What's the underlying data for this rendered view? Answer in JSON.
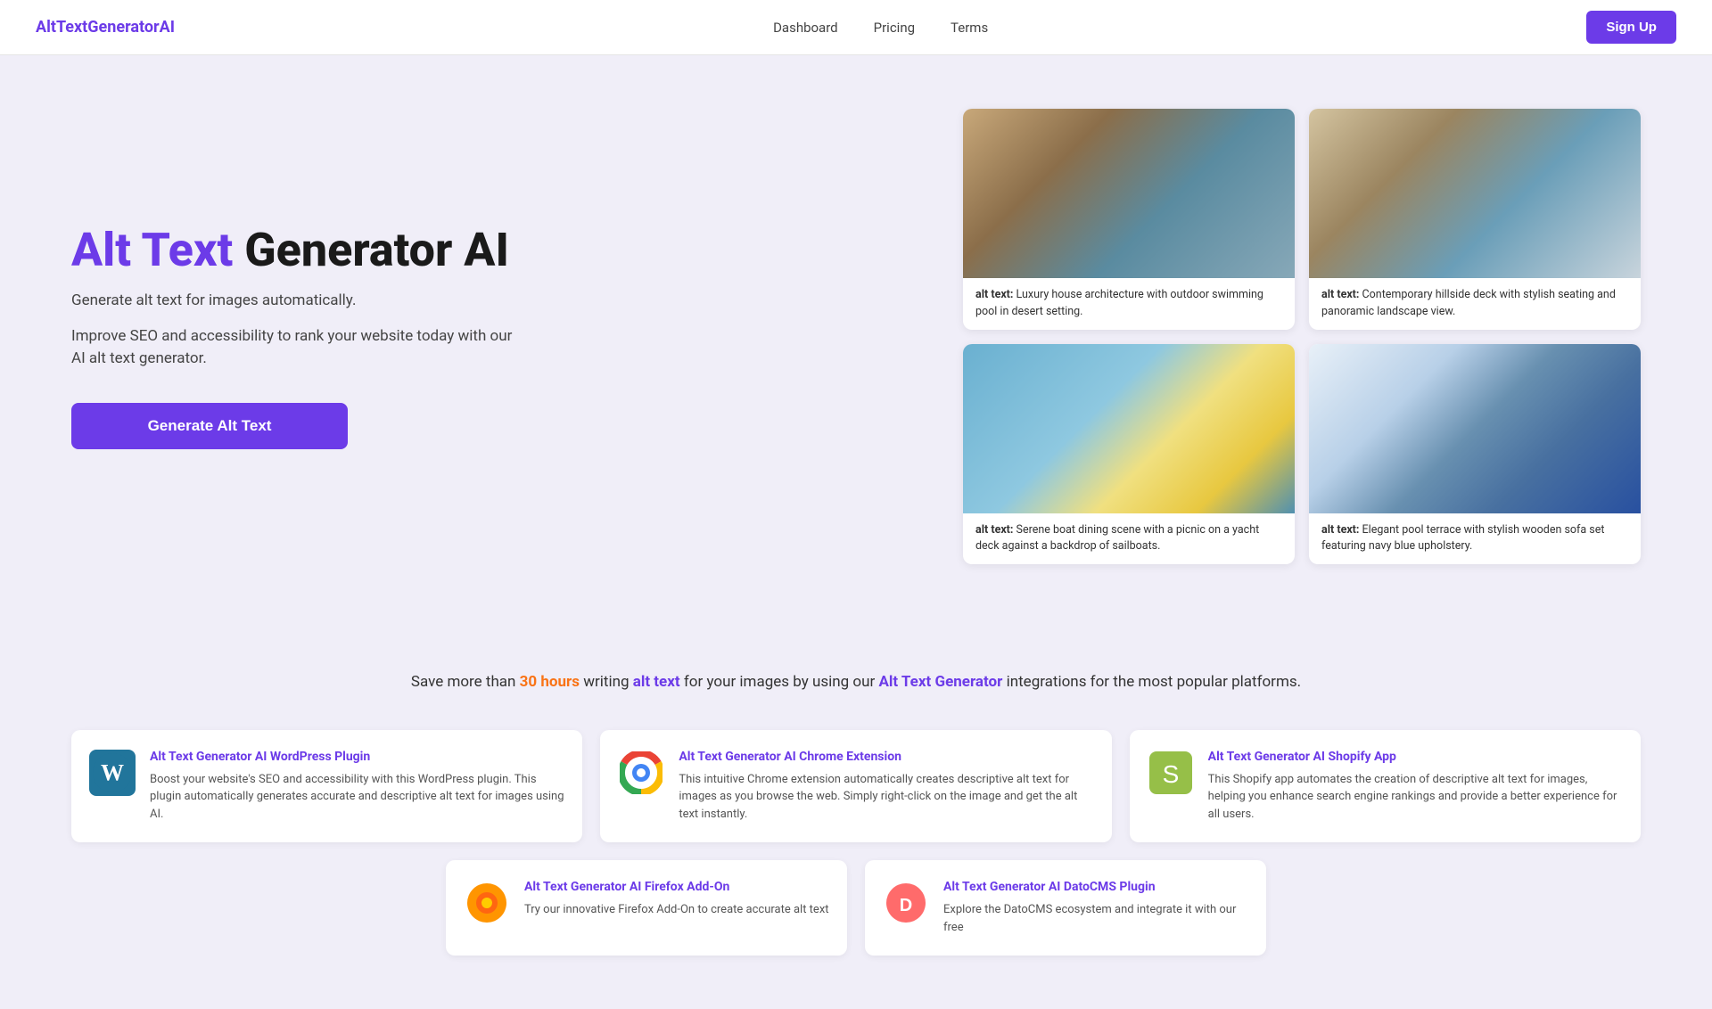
{
  "nav": {
    "logo_alt": "Alt",
    "logo_brand": "TextGeneratorAI",
    "links": [
      {
        "label": "Dashboard",
        "href": "#"
      },
      {
        "label": "Pricing",
        "href": "#"
      },
      {
        "label": "Terms",
        "href": "#"
      }
    ],
    "signup_label": "Sign Up"
  },
  "hero": {
    "title_purple": "Alt Text",
    "title_black": " Generator AI",
    "subtitle1": "Generate alt text for images automatically.",
    "subtitle2": "Improve SEO and accessibility to rank your website today with our AI alt text generator.",
    "cta_label": "Generate Alt Text",
    "images": [
      {
        "style_class": "img-house1",
        "alt_label": "alt text:",
        "alt_text": "Luxury house architecture with outdoor swimming pool in desert setting."
      },
      {
        "style_class": "img-deck",
        "alt_label": "alt text:",
        "alt_text": "Contemporary hillside deck with stylish seating and panoramic landscape view."
      },
      {
        "style_class": "img-boat",
        "alt_label": "alt text:",
        "alt_text": "Serene boat dining scene with a picnic on a yacht deck against a backdrop of sailboats."
      },
      {
        "style_class": "img-pool",
        "alt_label": "alt text:",
        "alt_text": "Elegant pool terrace with stylish wooden sofa set featuring navy blue upholstery."
      }
    ]
  },
  "integrations": {
    "intro_text": "Save more than ",
    "hours_highlight": "30 hours",
    "middle_text": " writing ",
    "alt_text_highlight": "alt text",
    "middle_text2": " for your images by using our ",
    "generator_highlight": "Alt Text Generator",
    "end_text": " integrations for the most popular platforms.",
    "cards": [
      {
        "id": "wordpress",
        "title": "Alt Text Generator AI WordPress Plugin",
        "description": "Boost your website's SEO and accessibility with this WordPress plugin. This plugin automatically generates accurate and descriptive alt text for images using AI.",
        "icon_type": "wordpress"
      },
      {
        "id": "chrome",
        "title": "Alt Text Generator AI Chrome Extension",
        "description": "This intuitive Chrome extension automatically creates descriptive alt text for images as you browse the web. Simply right-click on the image and get the alt text instantly.",
        "icon_type": "chrome"
      },
      {
        "id": "shopify",
        "title": "Alt Text Generator AI Shopify App",
        "description": "This Shopify app automates the creation of descriptive alt text for images, helping you enhance search engine rankings and provide a better experience for all users.",
        "icon_type": "shopify"
      },
      {
        "id": "firefox",
        "title": "Alt Text Generator AI Firefox Add-On",
        "description": "Try our innovative Firefox Add-On to create accurate alt text",
        "icon_type": "firefox"
      },
      {
        "id": "datocms",
        "title": "Alt Text Generator AI DatoCMS Plugin",
        "description": "Explore the DatoCMS ecosystem and integrate it with our free",
        "icon_type": "dato"
      }
    ]
  }
}
